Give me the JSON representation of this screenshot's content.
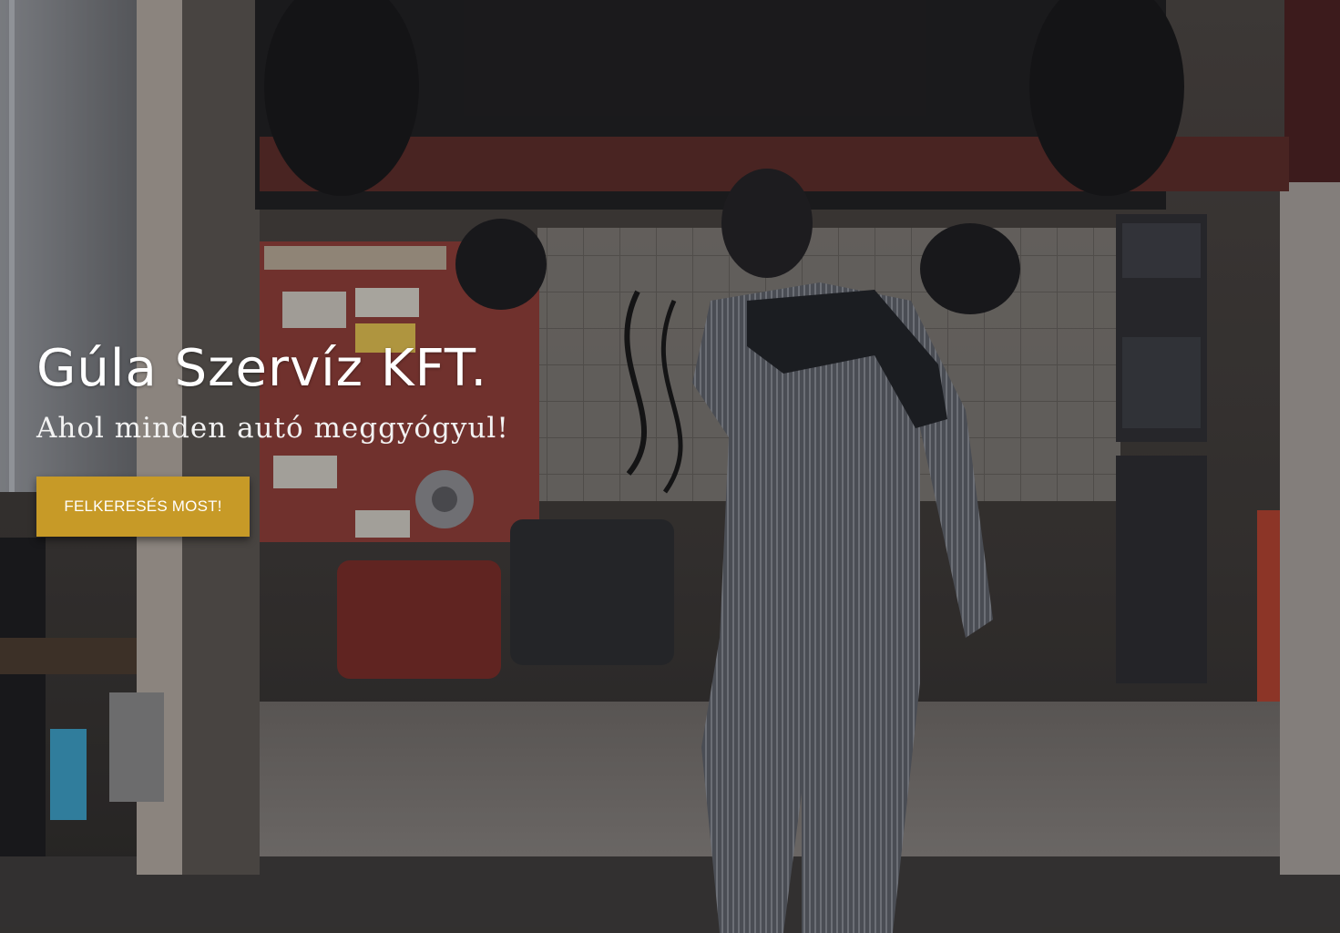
{
  "hero": {
    "title": "Gúla Szervíz KFT.",
    "subtitle": "Ahol minden autó meggyógyul!",
    "cta_label": "FELKERESÉS MOST!",
    "cta_color": "#c79a27",
    "background_image": "mechanic-working-under-lifted-car"
  }
}
